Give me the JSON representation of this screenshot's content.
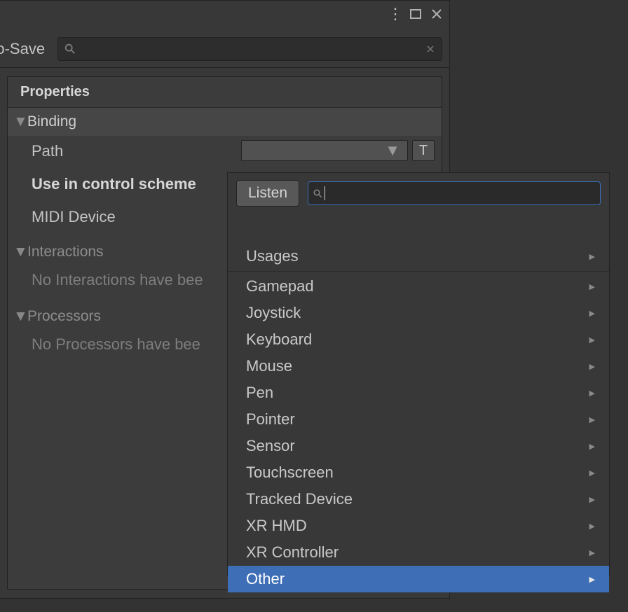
{
  "toolbar": {
    "autosave_label": "uto-Save",
    "search_value": ""
  },
  "properties": {
    "header": "Properties",
    "binding": {
      "title": "Binding",
      "path_label": "Path",
      "t_button": "T",
      "use_in_scheme_label": "Use in control scheme",
      "midi_label": "MIDI Device"
    },
    "interactions": {
      "title": "Interactions",
      "empty_text": "No Interactions have bee"
    },
    "processors": {
      "title": "Processors",
      "empty_text": "No Processors have bee"
    }
  },
  "popup": {
    "listen_label": "Listen",
    "search_value": "",
    "group_top": "Usages",
    "items": [
      "Gamepad",
      "Joystick",
      "Keyboard",
      "Mouse",
      "Pen",
      "Pointer",
      "Sensor",
      "Touchscreen",
      "Tracked Device",
      "XR HMD",
      "XR Controller"
    ],
    "selected": "Other"
  },
  "icons": {
    "search": "search-icon",
    "close": "close-icon",
    "maximize": "maximize-icon",
    "more": "kebab-icon",
    "chevron_down": "chevron-down-icon",
    "chevron_right": "chevron-right-icon"
  }
}
